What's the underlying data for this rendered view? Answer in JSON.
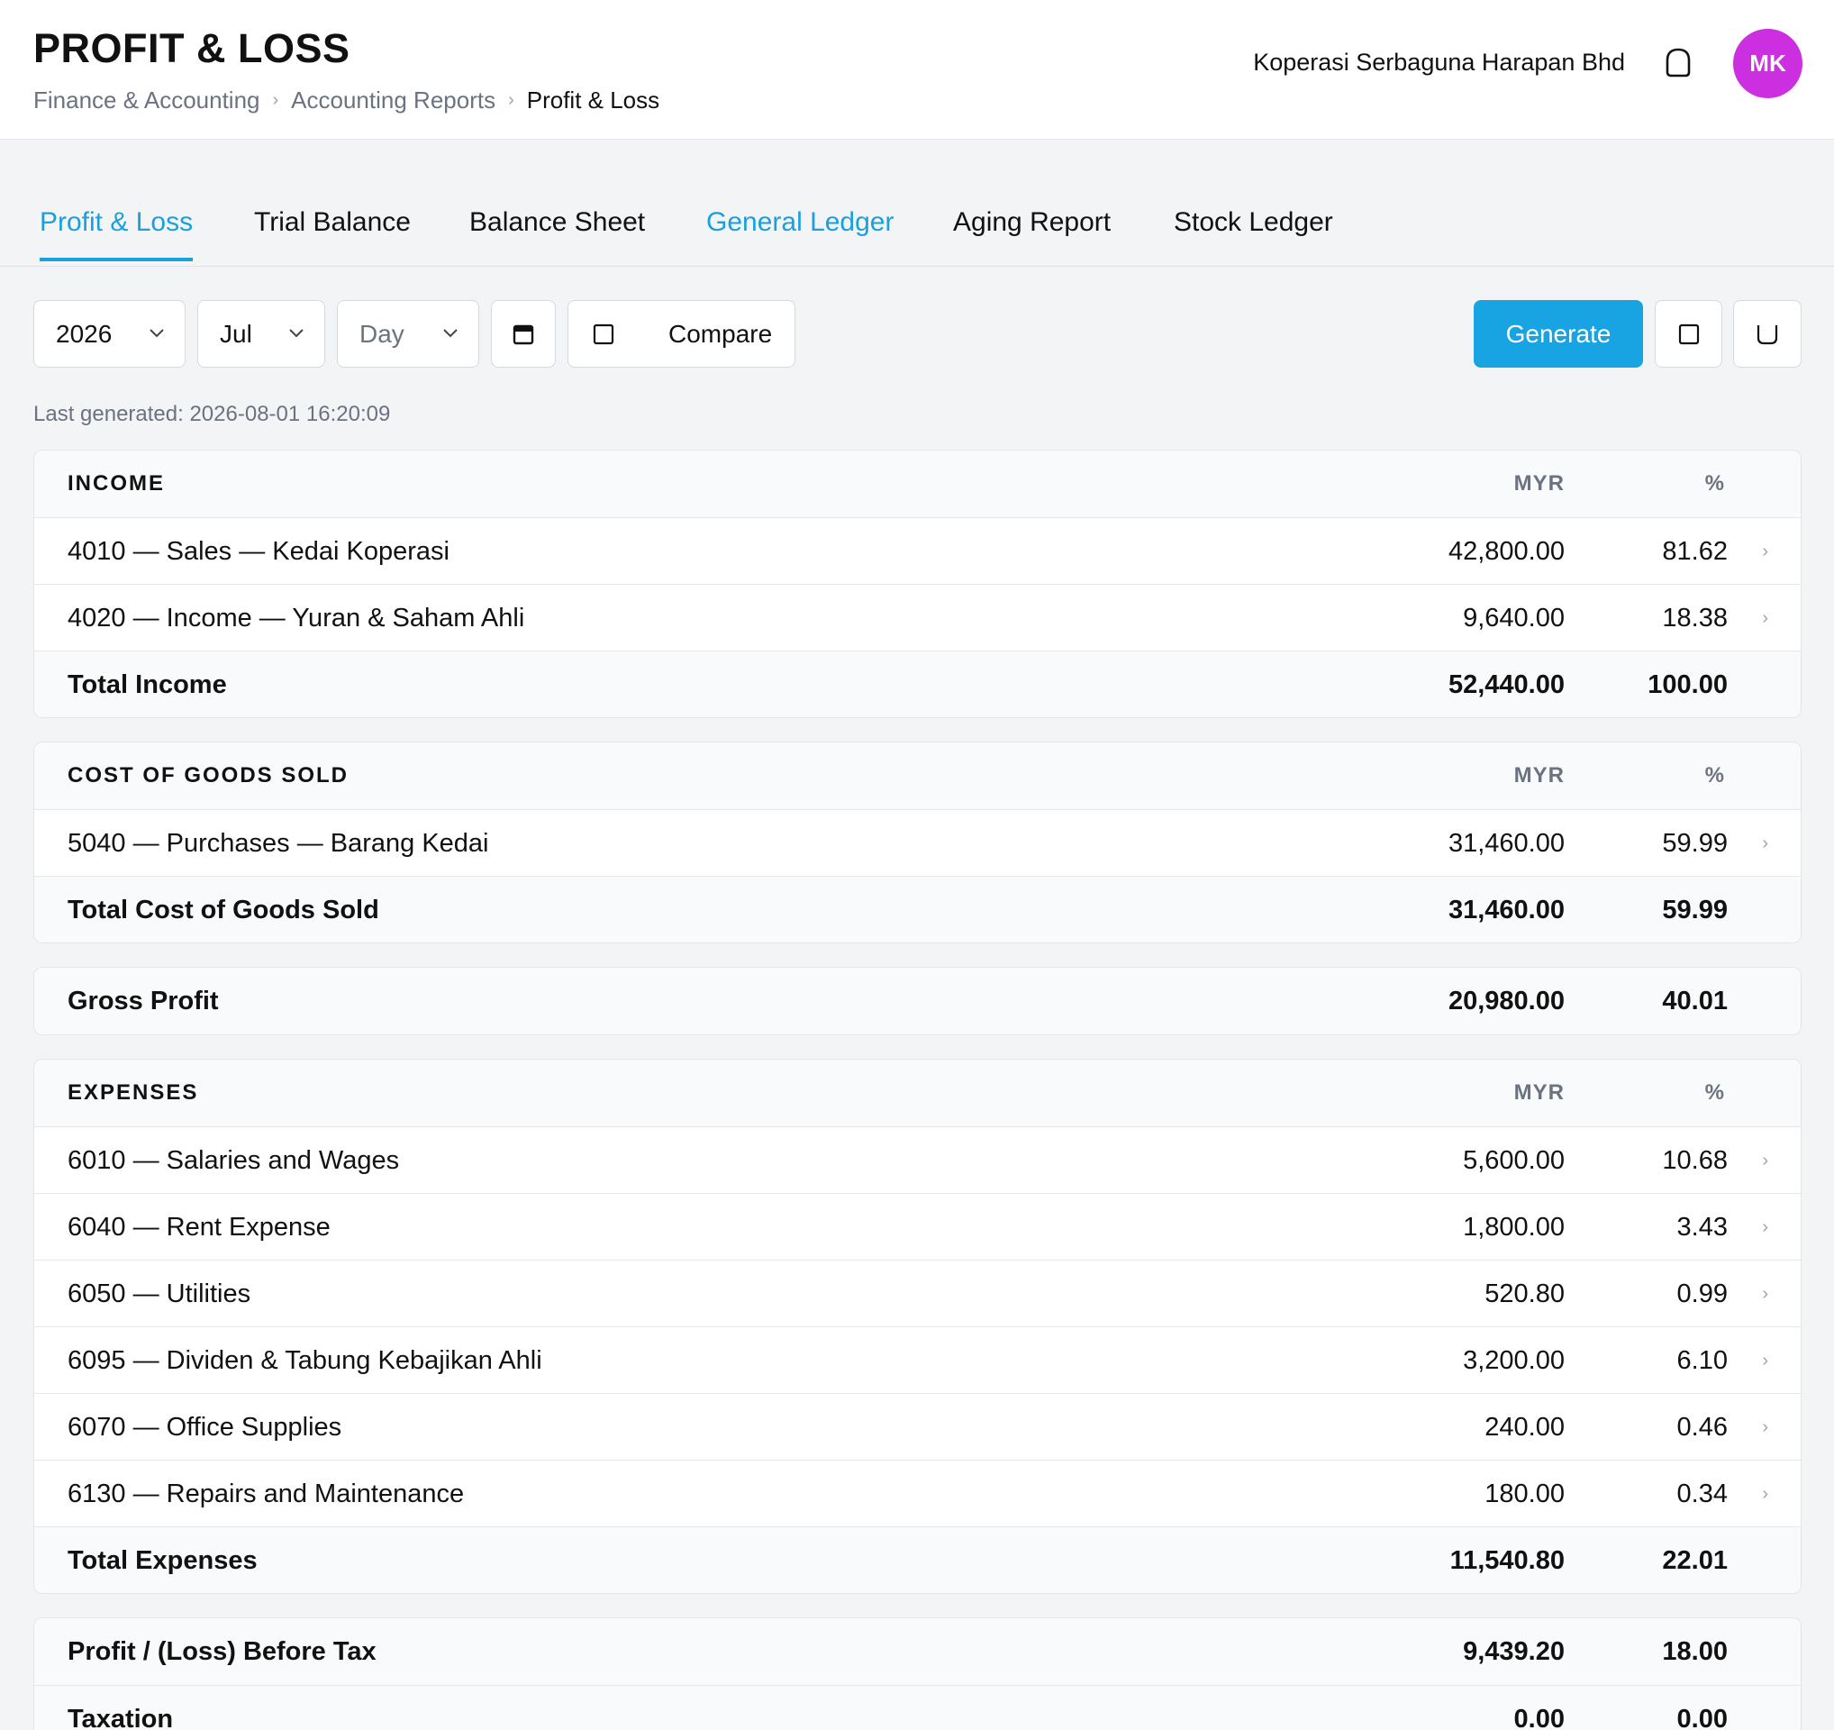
{
  "header": {
    "title": "PROFIT & LOSS",
    "breadcrumb": [
      "Finance & Accounting",
      "Accounting Reports",
      "Profit & Loss"
    ],
    "organization": "Koperasi Serbaguna Harapan Bhd",
    "avatar_initials": "MK",
    "bell_icon": "bell-icon",
    "avatar_color": "#cc2fe0"
  },
  "tabs": [
    {
      "label": "Profit & Loss"
    },
    {
      "label": "Trial Balance"
    },
    {
      "label": "Balance Sheet"
    },
    {
      "label": "General Ledger"
    },
    {
      "label": "Aging Report"
    },
    {
      "label": "Stock Ledger"
    }
  ],
  "toolbar": {
    "year": "2026",
    "month": "Jul",
    "day_placeholder": "Day",
    "calendar_icon": "calendar-icon",
    "compare_label": "Compare",
    "generate_label": "Generate",
    "accent_color": "#18a3e3"
  },
  "last_generated": "Last generated: 2026-08-01 16:20:09",
  "income": {
    "heading": "INCOME",
    "currency": "MYR",
    "pct": "%",
    "rows": [
      {
        "name": "4010 — Sales — Kedai Koperasi",
        "amount": "42,800.00",
        "pct": "81.62"
      },
      {
        "name": "4020 — Income — Yuran & Saham Ahli",
        "amount": "9,640.00",
        "pct": "18.38"
      }
    ],
    "total": {
      "name": "Total Income",
      "amount": "52,440.00",
      "pct": "100.00"
    }
  },
  "cogs": {
    "heading": "COST OF GOODS SOLD",
    "currency": "MYR",
    "pct": "%",
    "rows": [
      {
        "name": "5040 — Purchases — Barang Kedai",
        "amount": "31,460.00",
        "pct": "59.99"
      }
    ],
    "total": {
      "name": "Total Cost of Goods Sold",
      "amount": "31,460.00",
      "pct": "59.99"
    }
  },
  "gross_profit": {
    "name": "Gross Profit",
    "amount": "20,980.00",
    "pct": "40.01"
  },
  "expenses": {
    "heading": "EXPENSES",
    "currency": "MYR",
    "pct": "%",
    "rows": [
      {
        "name": "6010 — Salaries and Wages",
        "amount": "5,600.00",
        "pct": "10.68"
      },
      {
        "name": "6040 — Rent Expense",
        "amount": "1,800.00",
        "pct": "3.43"
      },
      {
        "name": "6050 — Utilities",
        "amount": "520.80",
        "pct": "0.99"
      },
      {
        "name": "6095 — Dividen & Tabung Kebajikan Ahli",
        "amount": "3,200.00",
        "pct": "6.10"
      },
      {
        "name": "6070 — Office Supplies",
        "amount": "240.00",
        "pct": "0.46"
      },
      {
        "name": "6130 — Repairs and Maintenance",
        "amount": "180.00",
        "pct": "0.34"
      }
    ],
    "total": {
      "name": "Total Expenses",
      "amount": "11,540.80",
      "pct": "22.01"
    }
  },
  "summary": {
    "before_tax": {
      "name": "Profit / (Loss) Before Tax",
      "amount": "9,439.20",
      "pct": "18.00"
    },
    "taxation": {
      "name": "Taxation",
      "amount": "0.00",
      "pct": "0.00"
    }
  }
}
